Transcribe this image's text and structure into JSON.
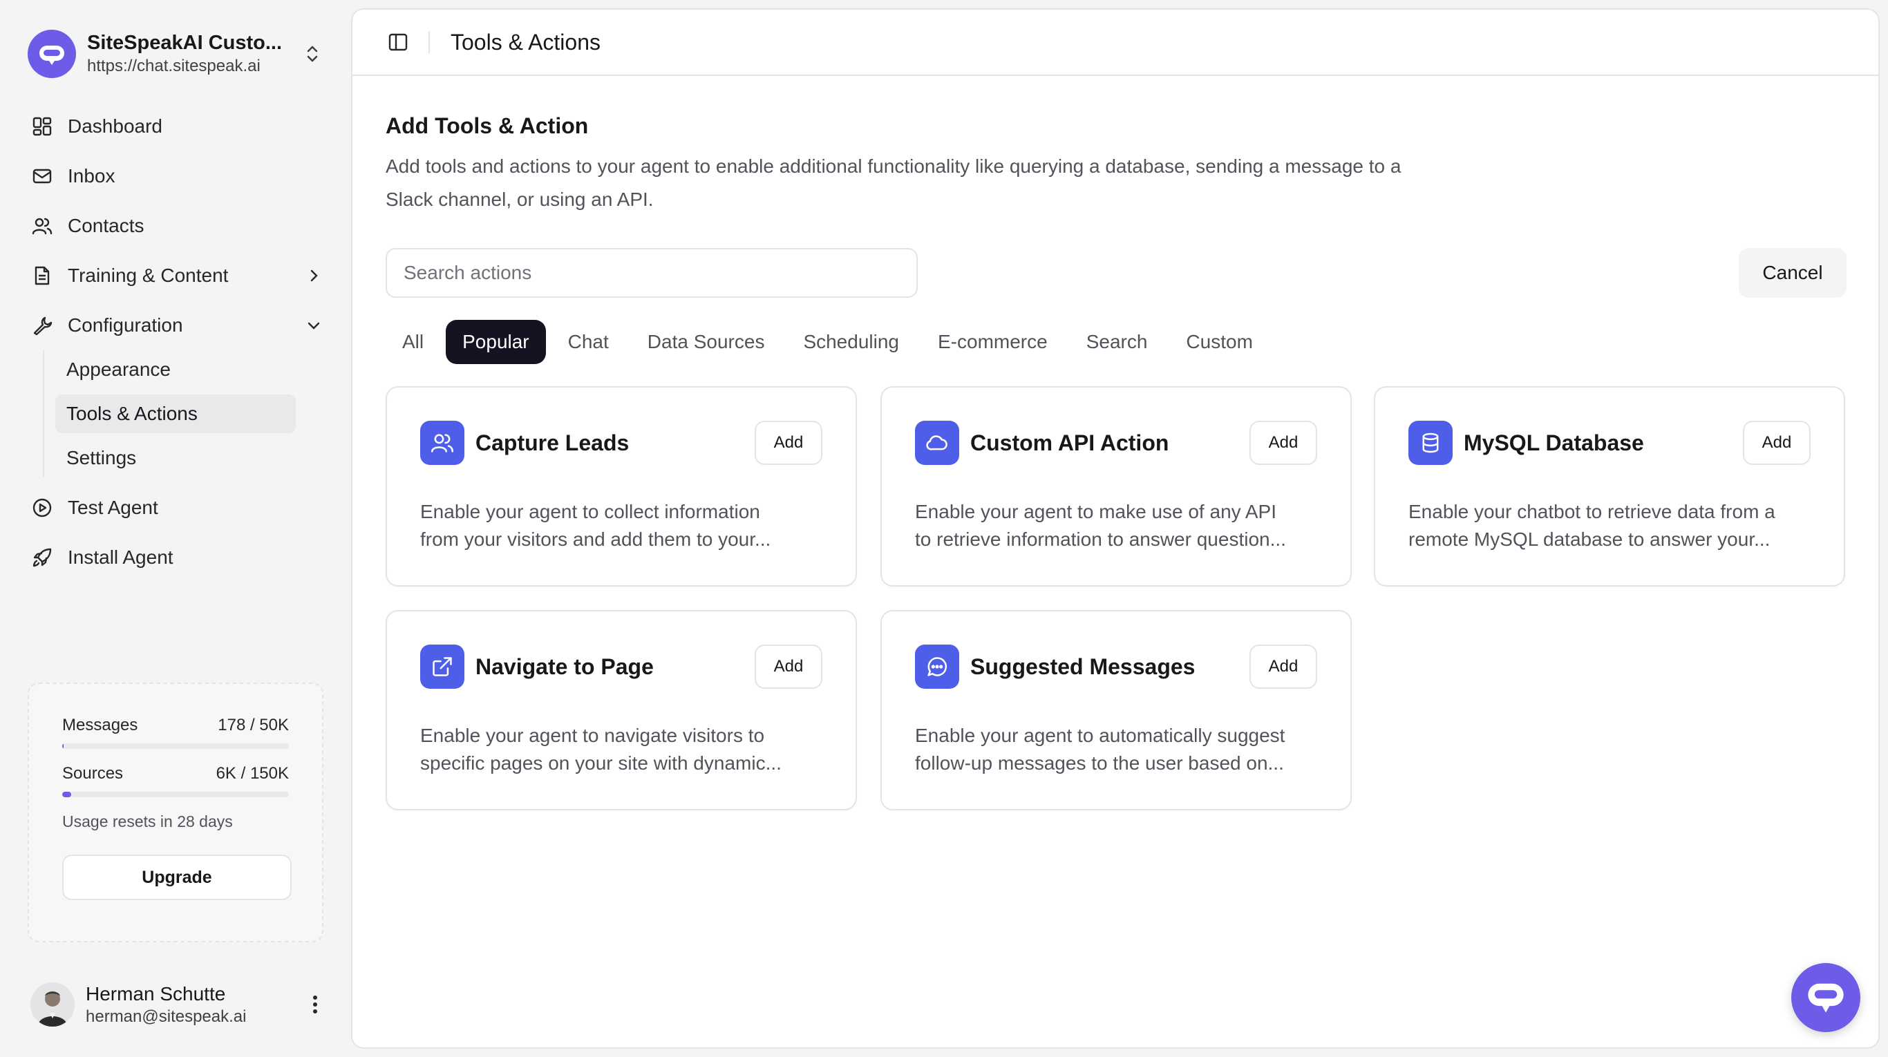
{
  "brand": {
    "name": "SiteSpeakAI Custo...",
    "url": "https://chat.sitespeak.ai"
  },
  "nav": {
    "dashboard": "Dashboard",
    "inbox": "Inbox",
    "contacts": "Contacts",
    "training": "Training & Content",
    "configuration": "Configuration",
    "sub": {
      "appearance": "Appearance",
      "tools": "Tools & Actions",
      "settings": "Settings"
    },
    "test_agent": "Test Agent",
    "install_agent": "Install Agent"
  },
  "usage": {
    "messages_label": "Messages",
    "messages_value": "178 / 50K",
    "messages_fraction": 0.004,
    "sources_label": "Sources",
    "sources_value": "6K / 150K",
    "sources_fraction": 0.04,
    "reset_text": "Usage resets in 28 days",
    "upgrade_label": "Upgrade"
  },
  "user": {
    "name": "Herman Schutte",
    "email": "herman@sitespeak.ai"
  },
  "topbar": {
    "title": "Tools & Actions"
  },
  "section": {
    "title": "Add Tools & Action",
    "description": "Add tools and actions to your agent to enable additional functionality like querying a database, sending a message to a Slack channel, or using an API."
  },
  "search": {
    "placeholder": "Search actions",
    "value": ""
  },
  "cancel_label": "Cancel",
  "tabs": [
    "All",
    "Popular",
    "Chat",
    "Data Sources",
    "Scheduling",
    "E-commerce",
    "Search",
    "Custom"
  ],
  "active_tab": "Popular",
  "cards": [
    {
      "title": "Capture Leads",
      "icon": "users-icon",
      "add": "Add",
      "line1": "Enable your agent to collect information",
      "line2": "from your visitors and add them to your..."
    },
    {
      "title": "Custom API Action",
      "icon": "cloud-icon",
      "add": "Add",
      "line1": "Enable your agent to make use of any API",
      "line2": "to retrieve information to answer question..."
    },
    {
      "title": "MySQL Database",
      "icon": "database-icon",
      "add": "Add",
      "line1": "Enable your chatbot to retrieve data from a",
      "line2": "remote MySQL database to answer your..."
    },
    {
      "title": "Navigate to Page",
      "icon": "external-link-icon",
      "add": "Add",
      "line1": "Enable your agent to navigate visitors to",
      "line2": "specific pages on your site with dynamic..."
    },
    {
      "title": "Suggested Messages",
      "icon": "message-circle-icon",
      "add": "Add",
      "line1": "Enable your agent to automatically suggest",
      "line2": "follow-up messages to the user based on..."
    }
  ],
  "colors": {
    "accent": "#6d5ce7",
    "card_icon": "#4f5ee8",
    "active_tab": "#161221"
  }
}
